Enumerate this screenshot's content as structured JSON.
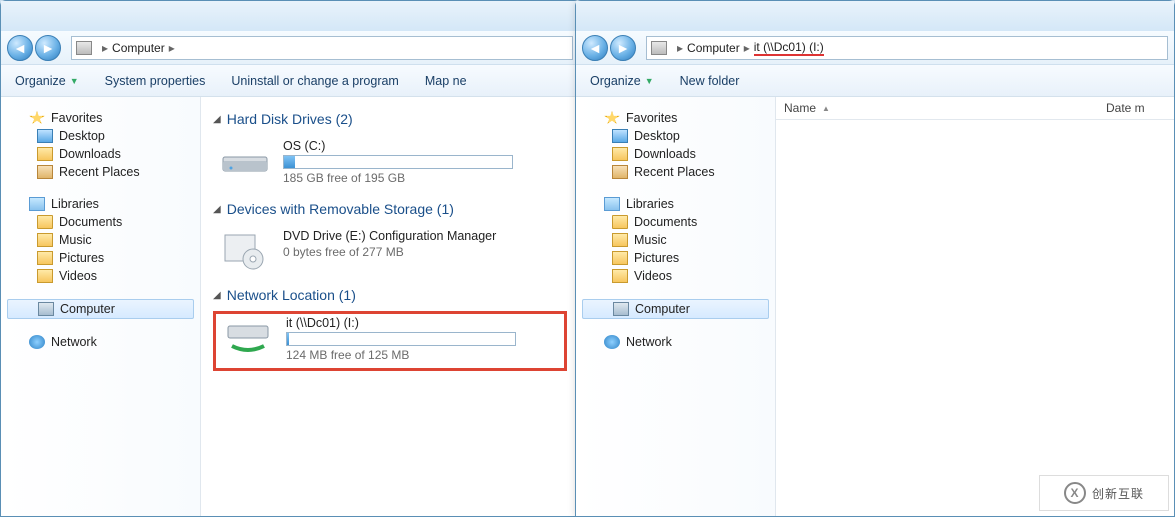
{
  "left": {
    "breadcrumb": [
      "Computer"
    ],
    "toolbar": {
      "organize": "Organize",
      "sysprops": "System properties",
      "uninstall": "Uninstall or change a program",
      "mapnet": "Map ne"
    },
    "sidebar": {
      "favorites": {
        "label": "Favorites",
        "items": [
          "Desktop",
          "Downloads",
          "Recent Places"
        ]
      },
      "libraries": {
        "label": "Libraries",
        "items": [
          "Documents",
          "Music",
          "Pictures",
          "Videos"
        ]
      },
      "computer": "Computer",
      "network": "Network"
    },
    "categories": {
      "hdd": {
        "title": "Hard Disk Drives (2)",
        "drives": [
          {
            "name": "OS (C:)",
            "free": "185 GB free of 195 GB",
            "fill_pct": 5
          }
        ]
      },
      "removable": {
        "title": "Devices with Removable Storage (1)",
        "drives": [
          {
            "name": "DVD Drive (E:) Configuration Manager",
            "free": "0 bytes free of 277 MB"
          }
        ]
      },
      "network": {
        "title": "Network Location (1)",
        "drives": [
          {
            "name": "it (\\\\Dc01) (I:)",
            "free": "124 MB free of 125 MB",
            "fill_pct": 1
          }
        ]
      }
    }
  },
  "right": {
    "breadcrumb": [
      "Computer",
      "it (\\\\Dc01) (I:)"
    ],
    "toolbar": {
      "organize": "Organize",
      "newfolder": "New folder"
    },
    "sidebar": {
      "favorites": {
        "label": "Favorites",
        "items": [
          "Desktop",
          "Downloads",
          "Recent Places"
        ]
      },
      "libraries": {
        "label": "Libraries",
        "items": [
          "Documents",
          "Music",
          "Pictures",
          "Videos"
        ]
      },
      "computer": "Computer",
      "network": "Network"
    },
    "columns": {
      "name": "Name",
      "date": "Date m"
    }
  },
  "watermark": "创新互联"
}
